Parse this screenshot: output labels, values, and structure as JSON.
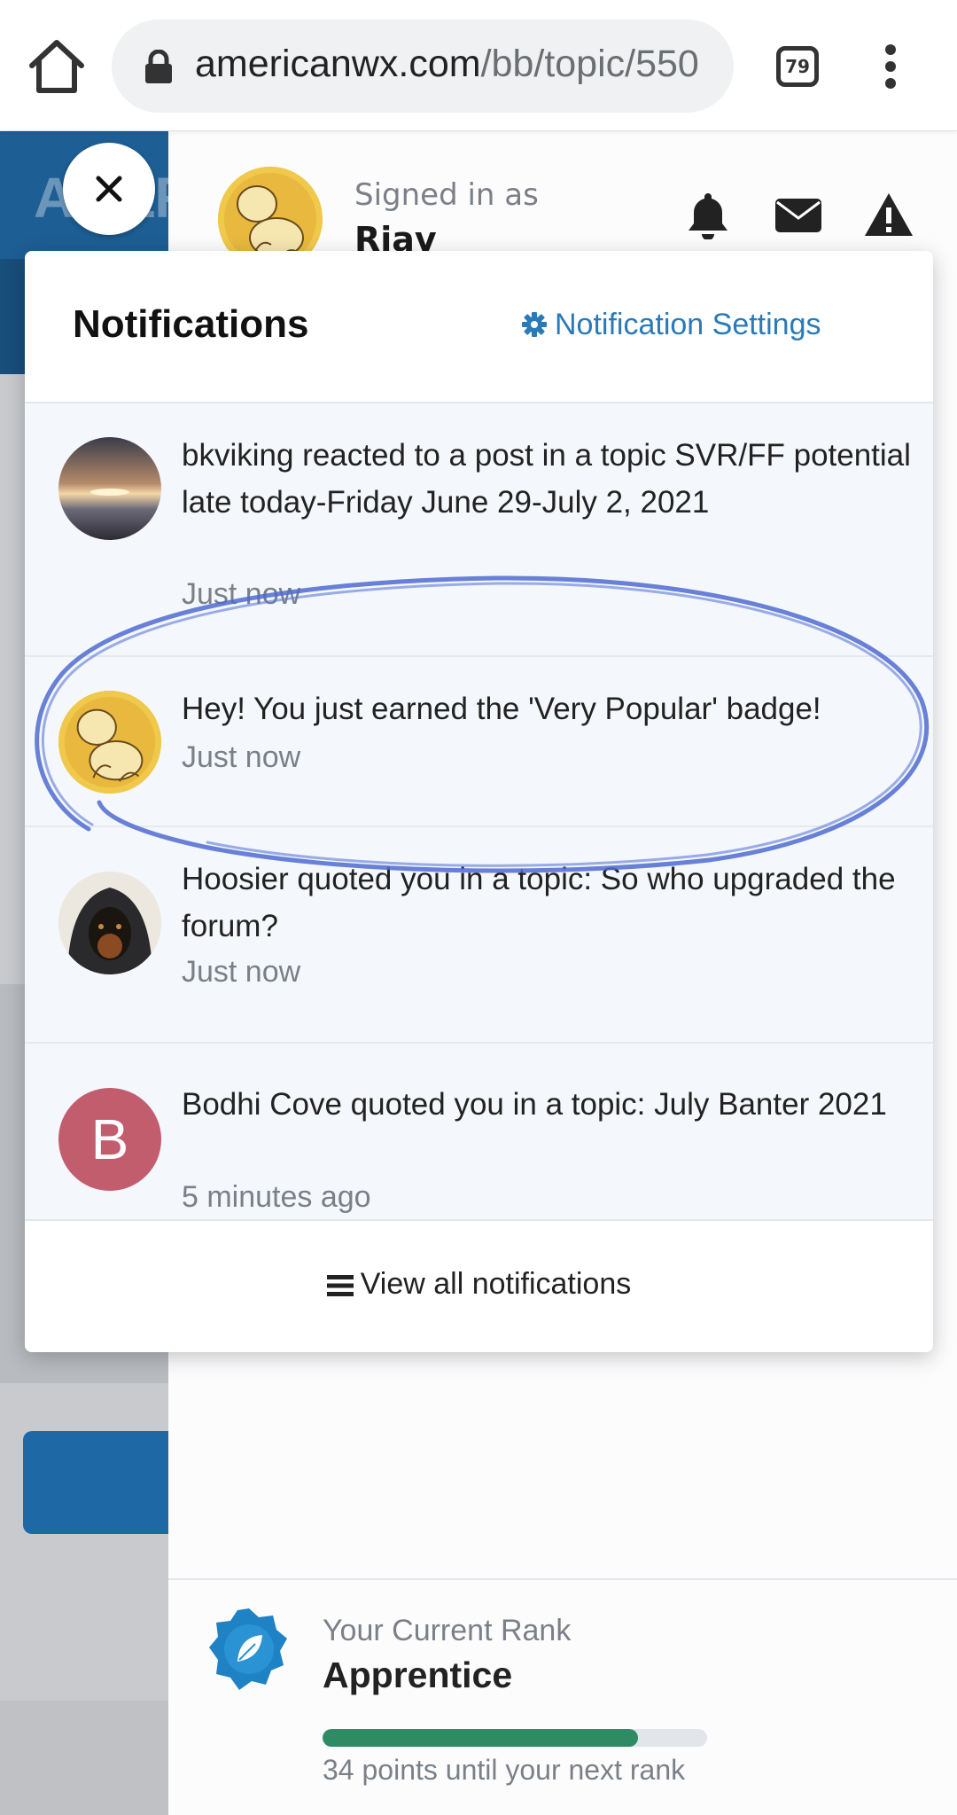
{
  "browser": {
    "url_domain": "americanwx.com",
    "url_path": "/bb/topic/550",
    "tab_count": "79"
  },
  "header": {
    "signed_in_label": "Signed in as",
    "user_name": "Riav"
  },
  "notifications": {
    "title": "Notifications",
    "settings_label": "Notification Settings",
    "items": [
      {
        "text": "bkviking reacted to a post in a topic SVR/FF potential late today-Friday June 29-July 2, 2021",
        "time": "Just now"
      },
      {
        "text": "Hey! You just earned the 'Very Popular' badge!",
        "time": "Just now"
      },
      {
        "text": "Hoosier quoted you in a topic: So who upgraded the forum?",
        "time": "Just now"
      },
      {
        "text": "Bodhi Cove quoted you in a topic: July Banter 2021",
        "time": "5 minutes ago",
        "avatar_letter": "B"
      }
    ],
    "view_all_label": "View all notifications"
  },
  "rank": {
    "label": "Your Current Rank",
    "name": "Apprentice",
    "progress": 0.82,
    "points_text": "34 points until your next rank"
  },
  "colors": {
    "link": "#2a7ab8",
    "brand_blue": "#1d5e94",
    "progress_green": "#2e8b64",
    "avatar_b": "#c25d6e",
    "annotation": "#4f6bd0"
  },
  "icons": [
    "home-icon",
    "lock-icon",
    "more-vert-icon",
    "close-icon",
    "bell-icon",
    "envelope-icon",
    "warning-icon",
    "gear-icon",
    "hamburger-icon",
    "leaf-badge-icon"
  ]
}
